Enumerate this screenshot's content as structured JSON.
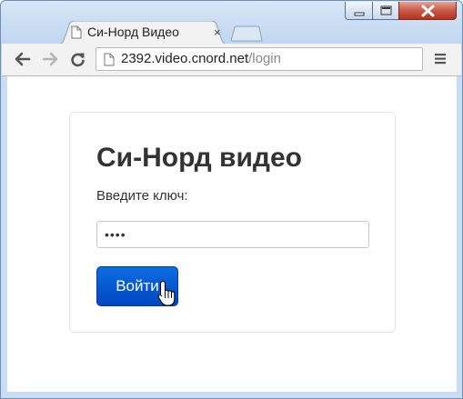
{
  "browser": {
    "tab_title": "Си-Норд Видео",
    "tab_close": "×",
    "url_host": "2392.video.cnord.net",
    "url_path": "/login"
  },
  "login": {
    "title": "Си-Норд видео",
    "key_label": "Введите ключ:",
    "key_value": "••••",
    "submit_label": "Войти"
  },
  "icons": {
    "back": "arrow-left-icon",
    "forward": "arrow-right-icon",
    "reload": "reload-icon",
    "page": "page-icon",
    "menu": "hamburger-menu-icon",
    "cursor": "hand-pointer-icon"
  },
  "colors": {
    "accent": "#0055cc",
    "frame": "#c9dcf2",
    "close": "#c75a47"
  }
}
